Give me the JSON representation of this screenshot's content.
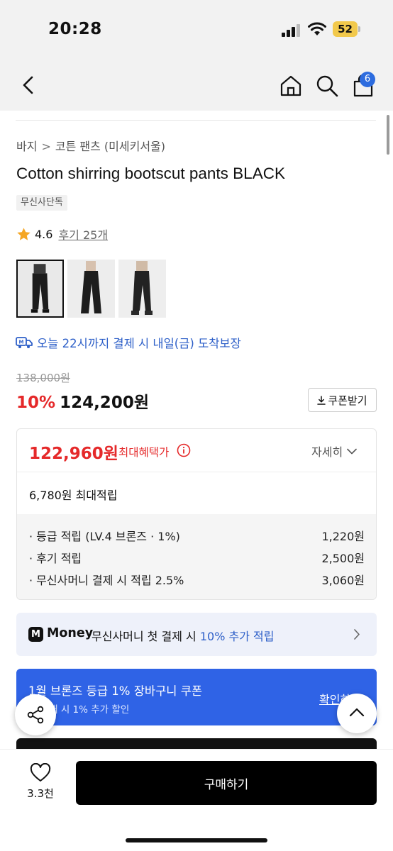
{
  "status_bar": {
    "time": "20:28",
    "battery": "52",
    "icons": [
      "cellular-signal-icon",
      "wifi-icon",
      "battery-icon"
    ]
  },
  "nav": {
    "icons": [
      "back-arrow-icon",
      "home-icon",
      "search-icon",
      "cart-icon"
    ],
    "cart_count": "6"
  },
  "breadcrumb": {
    "items": [
      "바지",
      "코튼 팬츠 (미세키서울)"
    ],
    "separator": ">"
  },
  "product": {
    "title": "Cotton shirring bootscut pants BLACK",
    "tag": "무신사단독",
    "rating": "4.6",
    "review_link": "후기 25개",
    "thumbnails_count": 3
  },
  "delivery": {
    "text": "오늘 22시까지 결제 시 내일(금) 도착보장"
  },
  "price": {
    "original": "138,000원",
    "discount_pct": "10%",
    "current": "124,200원",
    "coupon_button": "쿠폰받기"
  },
  "benefits": {
    "max_price": "122,960원",
    "max_label": "최대혜택가",
    "detail_link": "자세히",
    "points_total": "6,780원 최대적립",
    "rows": [
      {
        "label": "· 등급 적립 (LV.4 브론즈 · 1%)",
        "value": "1,220원"
      },
      {
        "label": "· 후기 적립",
        "value": "2,500원"
      },
      {
        "label": "· 무신사머니 결제 시 적립 2.5%",
        "value": "3,060원"
      }
    ]
  },
  "money_banner": {
    "logo": "M",
    "brand": "Money",
    "text_before": "무신사머니 첫 결제 시 ",
    "highlight": "10% 추가 적립"
  },
  "coupon_banner": {
    "title": "1월 브론즈 등급 1% 장바구니 쿠폰",
    "subtitle": "상 구매 시 1% 추가 할인",
    "link": "확인하기"
  },
  "bottom_bar": {
    "like_count": "3.3천",
    "buy_button": "구매하기"
  },
  "colors": {
    "accent_red": "#e5292a",
    "accent_blue": "#2d5fc8",
    "coupon_blue": "#2f63e6",
    "badge_blue": "#2d6cdf"
  }
}
